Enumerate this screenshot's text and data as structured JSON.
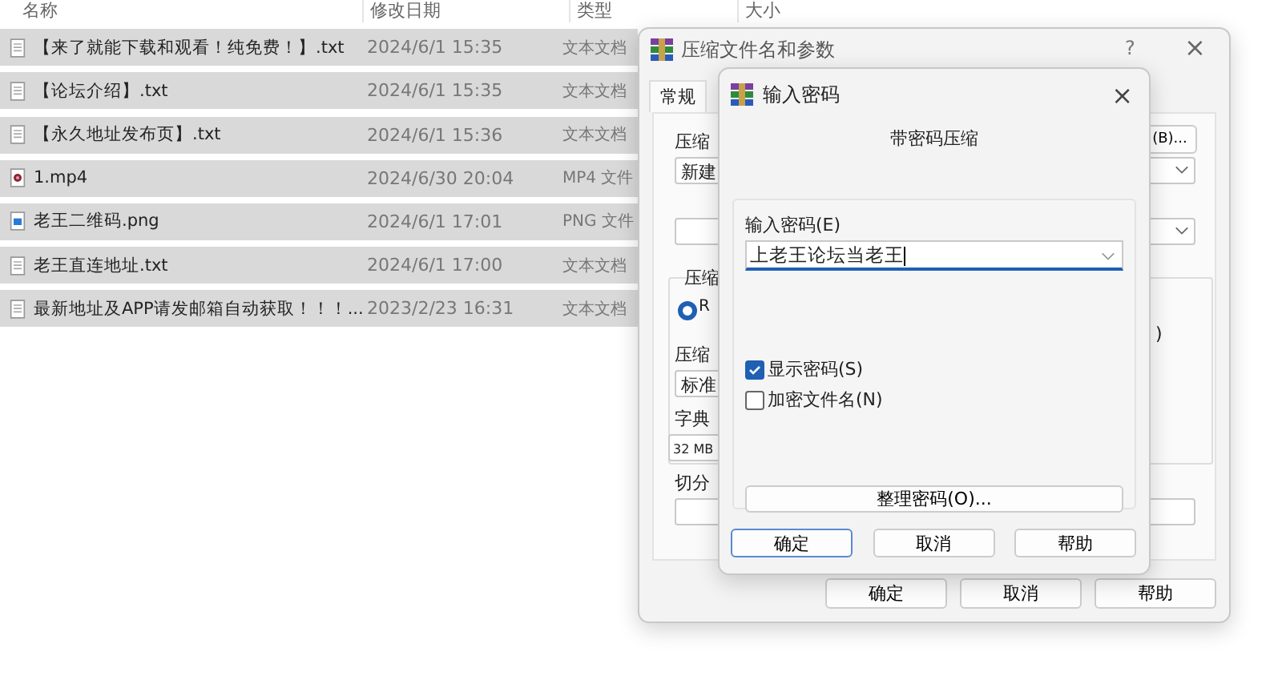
{
  "file_list": {
    "columns": [
      "名称",
      "修改日期",
      "类型",
      "大小"
    ],
    "rows": [
      {
        "kind": "text",
        "name": "【来了就能下载和观看！纯免费！】.txt",
        "date": "2024/6/1 15:35",
        "type": "文本文档",
        "selected": true
      },
      {
        "kind": "text",
        "name": "【论坛介绍】.txt",
        "date": "2024/6/1 15:35",
        "type": "文本文档",
        "selected": true
      },
      {
        "kind": "text",
        "name": "【永久地址发布页】.txt",
        "date": "2024/6/1 15:36",
        "type": "文本文档",
        "selected": true
      },
      {
        "kind": "video",
        "name": "1.mp4",
        "date": "2024/6/30 20:04",
        "type": "MP4 文件",
        "selected": true
      },
      {
        "kind": "image",
        "name": "老王二维码.png",
        "date": "2024/6/1 17:01",
        "type": "PNG 文件",
        "selected": true
      },
      {
        "kind": "text",
        "name": "老王直连地址.txt",
        "date": "2024/6/1 17:00",
        "type": "文本文档",
        "selected": true
      },
      {
        "kind": "text",
        "name": "最新地址及APP请发邮箱自动获取！！！...",
        "date": "2023/2/23 16:31",
        "type": "文本文档",
        "selected": true
      }
    ]
  },
  "archive_dialog": {
    "title": "压缩文件名和参数",
    "help": "?",
    "close": "×",
    "tabs": [
      {
        "label": "常规",
        "selected": true
      }
    ],
    "name_label": "压缩",
    "name_value": "新建",
    "browse_button": "(B)...",
    "group_label": "压缩",
    "radio": {
      "label": "R",
      "selected": true
    },
    "group_fragment": ")",
    "method_label": "压缩",
    "method_value": "标准",
    "dict_label": "字典",
    "dict_value": "32 MB",
    "split_label": "切分",
    "buttons": [
      "确定",
      "取消",
      "帮助"
    ]
  },
  "password_dialog": {
    "title": "输入密码",
    "close": "×",
    "subtitle": "带密码压缩",
    "password_label": "输入密码(E)",
    "password_value": "上老王论坛当老王",
    "options": [
      {
        "label": "显示密码(S)",
        "checked": true
      },
      {
        "label": "加密文件名(N)",
        "checked": false
      }
    ],
    "organize_button": "整理密码(O)...",
    "buttons": [
      {
        "label": "确定",
        "default": true
      },
      {
        "label": "取消",
        "default": false
      },
      {
        "label": "帮助",
        "default": false
      }
    ]
  }
}
